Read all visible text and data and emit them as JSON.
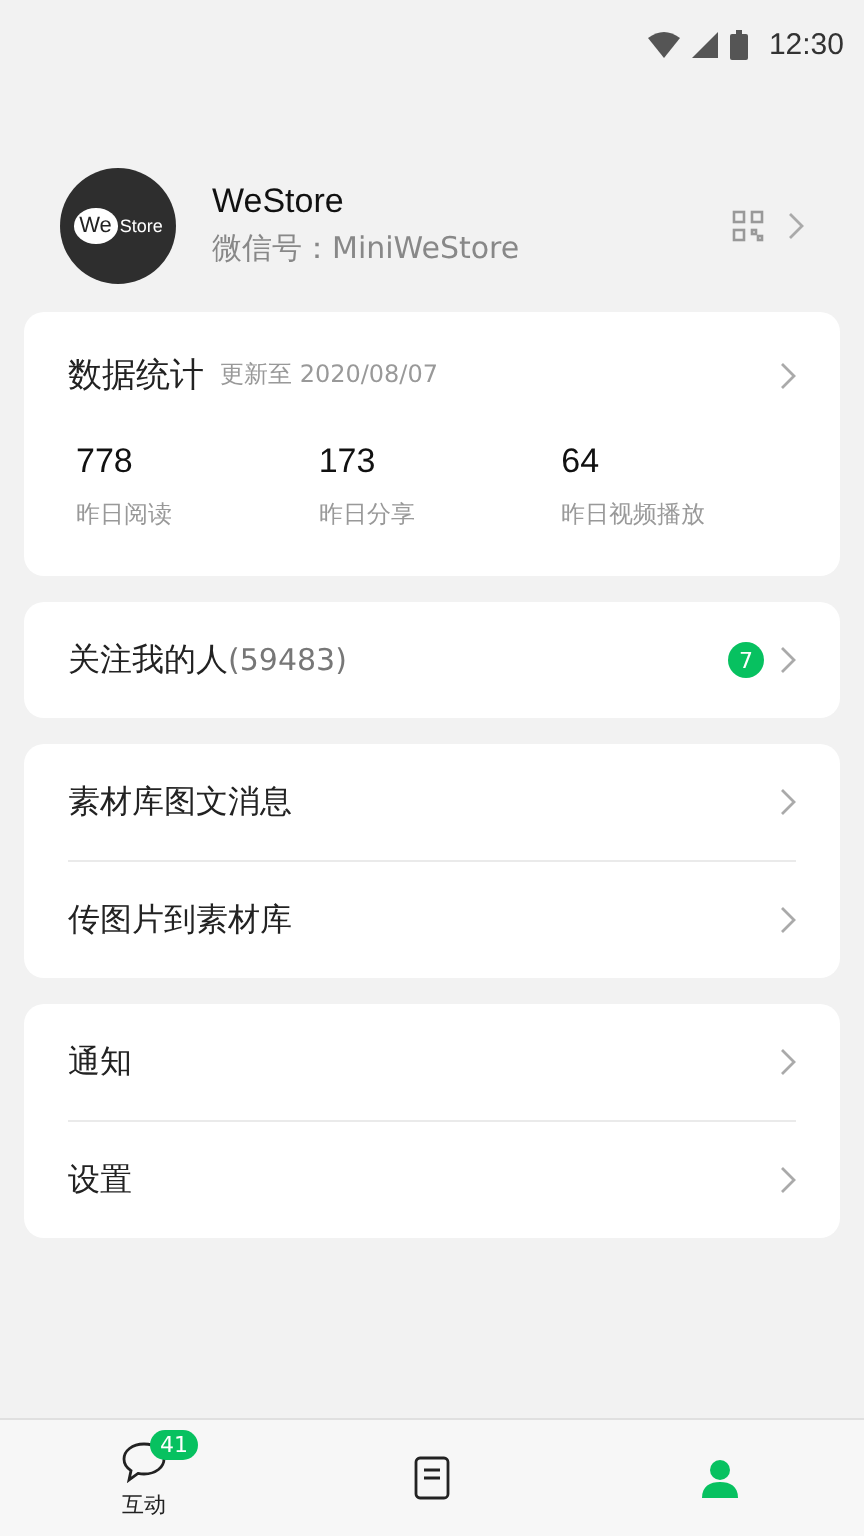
{
  "status_bar": {
    "time": "12:30"
  },
  "profile": {
    "name": "WeStore",
    "wechat_id": "微信号：MiniWeStore",
    "avatar_text": [
      "We",
      "Store"
    ]
  },
  "stats": {
    "title": "数据统计",
    "updated": "更新至 2020/08/07",
    "items": [
      {
        "value": "778",
        "label": "昨日阅读"
      },
      {
        "value": "173",
        "label": "昨日分享"
      },
      {
        "value": "64",
        "label": "昨日视频播放"
      }
    ]
  },
  "groups": [
    [
      {
        "label": "关注我的人",
        "count": "(59483)",
        "badge": "7"
      }
    ],
    [
      {
        "label": "素材库图文消息"
      },
      {
        "label": "传图片到素材库"
      }
    ],
    [
      {
        "label": "通知"
      },
      {
        "label": "设置"
      }
    ]
  ],
  "tabs": [
    {
      "kind": "chat",
      "label": "互动",
      "badge": "41",
      "selected": false
    },
    {
      "kind": "doc",
      "selected": false
    },
    {
      "kind": "person",
      "selected": true
    }
  ]
}
